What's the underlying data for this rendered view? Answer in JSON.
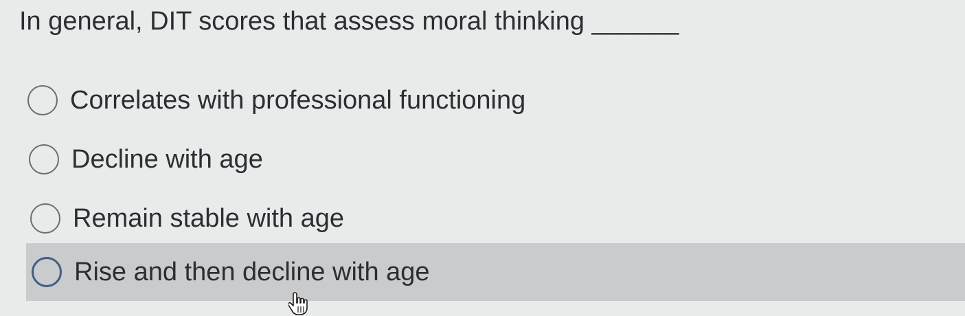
{
  "question": {
    "text": "In general, DIT scores that assess moral thinking ______"
  },
  "options": [
    {
      "label": "Correlates with professional functioning",
      "selected": false
    },
    {
      "label": "Decline with age",
      "selected": false
    },
    {
      "label": "Remain stable with age",
      "selected": false
    },
    {
      "label": "Rise and then decline with age",
      "selected": false,
      "hovered": true
    }
  ],
  "cursor": {
    "icon": "hand-pointer-icon"
  }
}
